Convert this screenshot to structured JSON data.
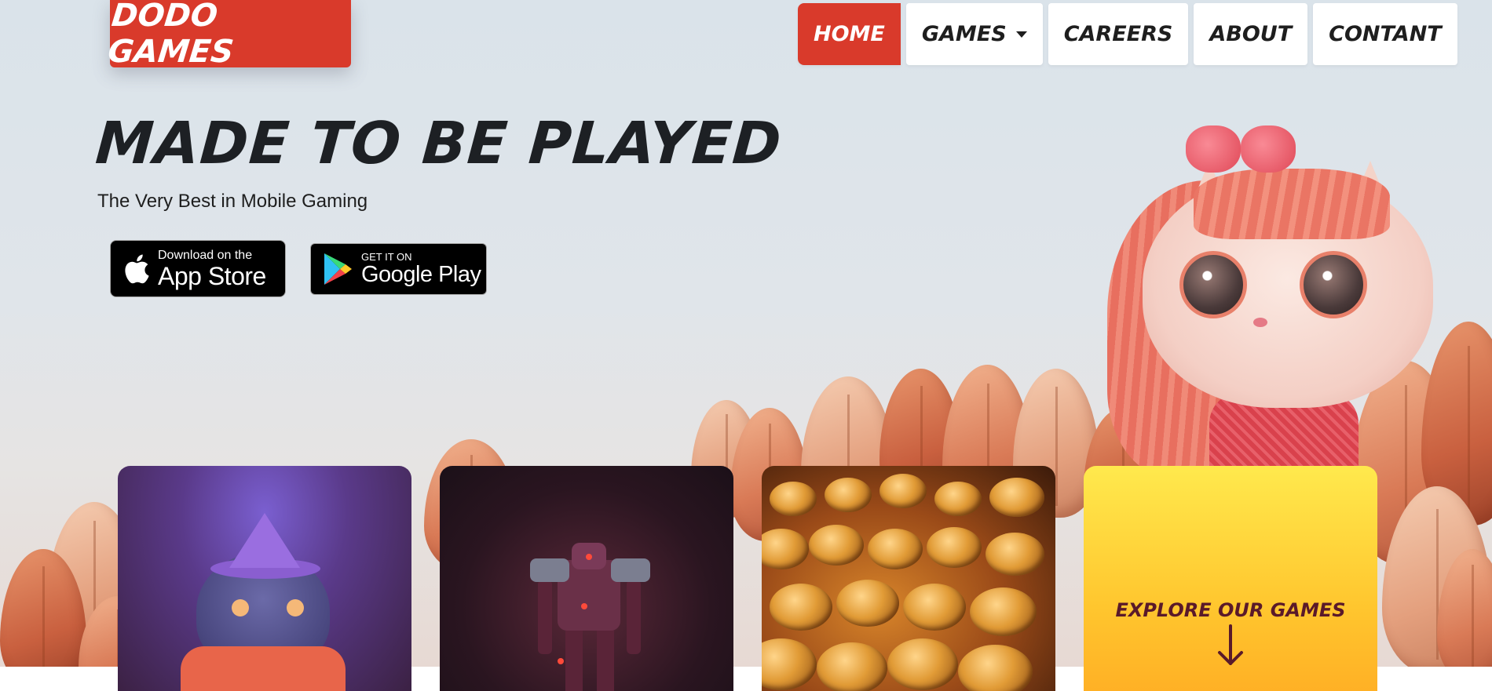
{
  "brand": {
    "logo_text": "DODO GAMES"
  },
  "nav": {
    "items": [
      {
        "label": "HOME",
        "active": true
      },
      {
        "label": "GAMES",
        "has_dropdown": true
      },
      {
        "label": "CAREERS"
      },
      {
        "label": "ABOUT"
      },
      {
        "label": "CONTANT"
      }
    ]
  },
  "hero": {
    "headline": "MADE TO BE PLAYED",
    "subtitle": "The Very Best in Mobile Gaming"
  },
  "stores": {
    "app_store": {
      "small": "Download on the",
      "big": "App Store",
      "icon": "apple-icon"
    },
    "google_play": {
      "small": "GET IT ON",
      "big": "Google Play",
      "icon": "google-play-icon"
    }
  },
  "cards": {
    "explore": {
      "label": "EXPLORE OUR GAMES",
      "icon": "arrow-down-icon"
    }
  },
  "colors": {
    "accent": "#d93a2b",
    "nav_bg": "#ffffff",
    "headline": "#1d2024",
    "explore_text": "#5a1a2a",
    "explore_bg_top": "#ffe94d",
    "explore_bg_bottom": "#ffae24"
  }
}
